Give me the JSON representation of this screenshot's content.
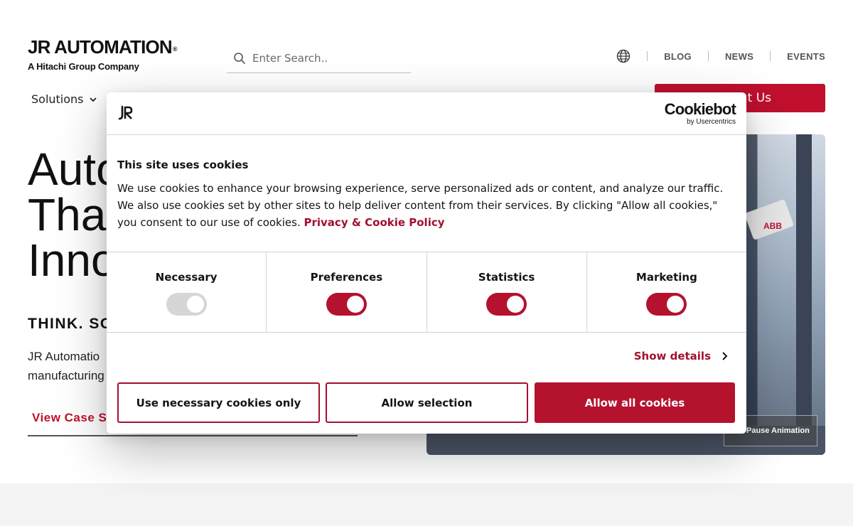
{
  "header": {
    "logo_text": "JR AUTOMATION",
    "logo_registered": "®",
    "logo_subtitle": "A Hitachi Group Company",
    "search_placeholder": "Enter Search..",
    "utility_links": [
      "BLOG",
      "NEWS",
      "EVENTS"
    ],
    "nav_solutions": "Solutions",
    "contact_label": "t Us"
  },
  "hero": {
    "title": "Auto\nTha\nInno",
    "tagline": "THINK. SO",
    "body_line1": "JR Automatio",
    "body_line2": "manufacturing",
    "case_link": "View Case St",
    "media_brand": "ABB",
    "pause_label": "Pause Animation"
  },
  "cookie_dialog": {
    "provider_name": "Cookiebot",
    "provider_by": "by Usercentrics",
    "title": "This site uses cookies",
    "text": "We use cookies to enhance your browsing experience, serve personalized ads or content, and analyze our traffic. We also use cookies set by other sites to help deliver content from their services. By clicking \"Allow all cookies,\" you consent to our use of cookies.",
    "policy_link": "Privacy & Cookie Policy",
    "categories": [
      {
        "label": "Necessary",
        "enabled": true,
        "locked": true
      },
      {
        "label": "Preferences",
        "enabled": true
      },
      {
        "label": "Statistics",
        "enabled": true
      },
      {
        "label": "Marketing",
        "enabled": true
      }
    ],
    "show_details": "Show details",
    "buttons": {
      "necessary_only": "Use necessary cookies only",
      "allow_selection": "Allow selection",
      "allow_all": "Allow all cookies"
    },
    "colors": {
      "accent": "#b5122e",
      "link": "#a3102e",
      "toggle_disabled": "#d6d6d6"
    }
  }
}
